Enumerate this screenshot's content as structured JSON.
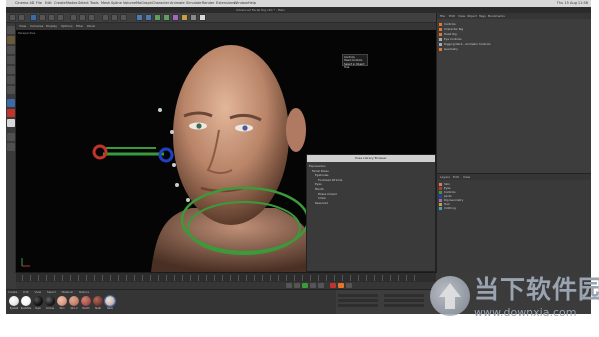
{
  "menubar": {
    "items": [
      "Cinema 4D",
      "File",
      "Edit",
      "Create",
      "Modes",
      "Select",
      "Tools",
      "Mesh",
      "Spline",
      "Volume",
      "MoGraph",
      "Character",
      "Animate",
      "Simulate",
      "Render",
      "Extensions",
      "Window",
      "Help"
    ],
    "clock": "Thu 15 Aug 11:58"
  },
  "title": "Advanced Facial Rig.c4d * - Main",
  "viewport": {
    "menu": [
      "View",
      "Cameras",
      "Display",
      "Options",
      "Filter",
      "Panel"
    ],
    "label": "Perspective"
  },
  "tooltip": {
    "lines": [
      "Controls",
      "Head Controls",
      "Select in Object Tree"
    ]
  },
  "pose_library_browser": {
    "title": "Pose Library Browser",
    "items": [
      "Expressions",
      "Facial Poses",
      "Eyebrows",
      "Forehead Wrinkle",
      "Eyes",
      "Mouth",
      "Phase Closed",
      "Smile",
      "Reserved"
    ]
  },
  "object_manager": {
    "menu": [
      "File",
      "Edit",
      "View",
      "Object",
      "Tags",
      "Bookmarks"
    ],
    "rows": [
      "Controls",
      "Character Rig",
      "Head Rig",
      "Eye Controls",
      "Rigging Neck - Animator Controls",
      "Geometry"
    ]
  },
  "layers_panel": {
    "menu": [
      "Layers",
      "Edit",
      "View"
    ],
    "rows": [
      "Skin",
      "Eyes",
      "Controls",
      "Joints",
      "Rig Geometry",
      "Hair",
      "Clothing"
    ]
  },
  "materials": {
    "menu": [
      "Create",
      "Edit",
      "View",
      "Select",
      "Material",
      "Texture"
    ],
    "swatches": [
      {
        "label": "Eyeball",
        "color": "#e8e8e8"
      },
      {
        "label": "Eyewhite",
        "color": "#f5f5f5"
      },
      {
        "label": "Pupil",
        "color": "#111111"
      },
      {
        "label": "Cornea",
        "color": "#1a1a1a"
      },
      {
        "label": "Skin",
        "color": "#d69a84"
      },
      {
        "label": "Skin 2",
        "color": "#c47f6a"
      },
      {
        "label": "Mouth",
        "color": "#a9534c"
      },
      {
        "label": "Teeth",
        "color": "#7a3a30"
      },
      {
        "label": "Nails",
        "color": "#c9b7b0"
      }
    ]
  },
  "watermark": {
    "brand": "当下软件园",
    "url": "www.downxia.com"
  },
  "colors": {
    "accent_orange": "#e8732a",
    "control_red": "#c0342c",
    "control_green": "#3b9a3a",
    "control_blue": "#2040c0"
  }
}
